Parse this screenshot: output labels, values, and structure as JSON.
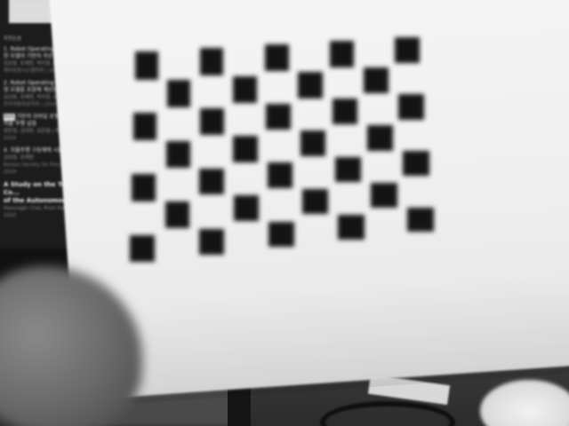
{
  "monitor": {
    "header": "추천논문",
    "items": [
      {
        "title": "1. Robot Operating System 을 ...",
        "title2": "     한 모델의 기반의 차선 인식 알고리...",
        "meta": "김상윤, 유재현, 박지원, 윤우식",
        "source": "제어로봇시스템학회 | 2018"
      },
      {
        "title": "2. Robot Operating System 기반 ...",
        "title2": "     형 모델을 포함해 계산된 맥락을...",
        "meta": "김상윤, 유재현, 박지원, 윤우식",
        "source": "한국자동차공학회 | 2019"
      },
      {
        "tag": "ROS",
        "title": " 기반의 모바일 로봇 시스템 개발 및 ...",
        "title2": "자율 주행 실험",
        "meta": "정찬영, 김대현, 심은철 | 제어로봇시스템학회",
        "source": "2019"
      },
      {
        "title": "4. 자율주행 구동체에 시뮬레이션",
        "meta": "김상윤, 유재현",
        "source": "Korean Society for Precision Engineering",
        "year": "2019"
      },
      {
        "big": "A Study on the Transfer to Drive Co...",
        "big2": "of the Autonomous Vehicle",
        "meta": "Hyoungjin Choi, Piron Park | 대한전기 ...",
        "year": "2020"
      }
    ]
  },
  "board": {
    "pattern": "checkerboard",
    "rows": 7,
    "cols": 9
  }
}
